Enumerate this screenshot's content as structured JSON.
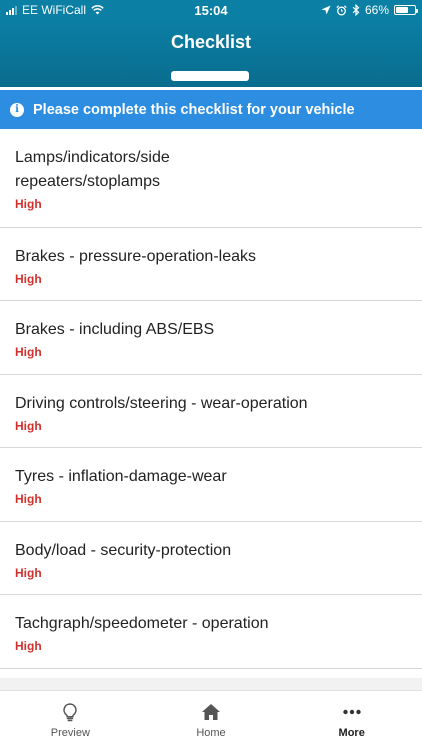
{
  "status_bar": {
    "carrier": "EE WiFiCall",
    "time": "15:04",
    "battery": "66%",
    "battery_level": 0.66
  },
  "header": {
    "title": "Checklist"
  },
  "banner": {
    "icon": "info-icon",
    "text": "Please complete this checklist for your vehicle"
  },
  "checklist": {
    "items": [
      {
        "title": "Lamps/indicators/side repeaters/stoplamps",
        "priority": "High"
      },
      {
        "title": "Brakes - pressure-operation-leaks",
        "priority": "High"
      },
      {
        "title": "Brakes - including ABS/EBS",
        "priority": "High"
      },
      {
        "title": "Driving controls/steering - wear-operation",
        "priority": "High"
      },
      {
        "title": "Tyres - inflation-damage-wear",
        "priority": "High"
      },
      {
        "title": "Body/load - security-protection",
        "priority": "High"
      },
      {
        "title": "Tachgraph/speedometer - operation",
        "priority": "High"
      }
    ]
  },
  "tab_bar": {
    "tabs": [
      {
        "label": "Preview",
        "icon": "lightbulb-icon",
        "active": false
      },
      {
        "label": "Home",
        "icon": "home-icon",
        "active": false
      },
      {
        "label": "More",
        "icon": "more-dots-icon",
        "active": true
      }
    ]
  },
  "colors": {
    "header": "#0b7fa4",
    "banner": "#2d8de0",
    "priority_high": "#d0312d"
  }
}
